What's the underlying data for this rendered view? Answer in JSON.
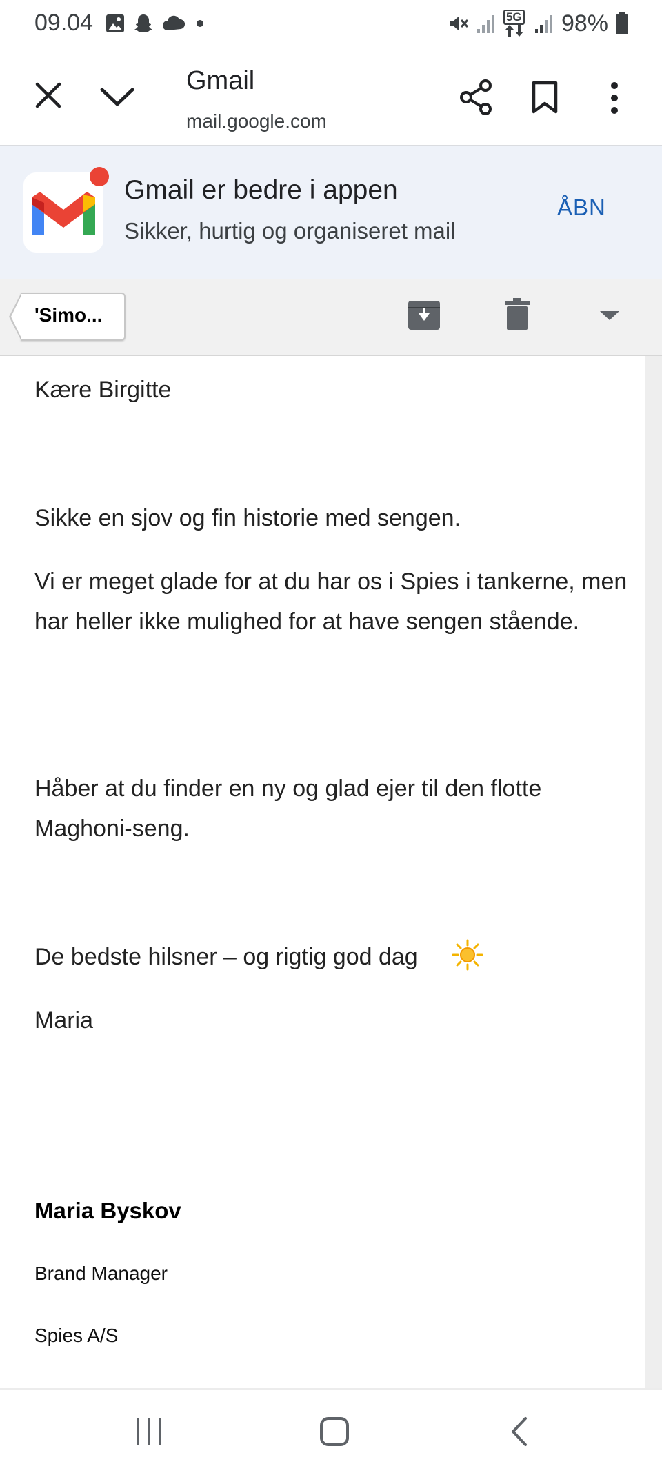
{
  "status_bar": {
    "time": "09.04",
    "network": "5G",
    "battery": "98%",
    "left_icons": [
      "gallery-icon",
      "snapchat-icon",
      "cloud-icon",
      "dot-icon"
    ],
    "right_icons": [
      "mute-icon",
      "signal-icon",
      "signal-icon",
      "battery-icon"
    ]
  },
  "browser": {
    "title": "Gmail",
    "url": "mail.google.com",
    "icons": [
      "close-icon",
      "chevron-down-icon",
      "share-icon",
      "bookmark-icon",
      "more-vert-icon"
    ]
  },
  "app_banner": {
    "title": "Gmail er bedre i appen",
    "subtitle": "Sikker, hurtig og organiseret mail",
    "open_label": "ÅBN",
    "logo_colors": {
      "blue": "#4285f4",
      "red": "#ea4335",
      "yellow": "#fbbc04",
      "green": "#34a853"
    }
  },
  "mail_toolbar": {
    "back_label": "'Simo...",
    "icons": [
      "archive-icon",
      "trash-icon",
      "dropdown-icon"
    ]
  },
  "email": {
    "greeting": "Kære Birgitte",
    "paragraphs": [
      "Sikke en sjov og fin historie med sengen.",
      "Vi er meget glade for at du har os i Spies i tankerne, men har heller ikke mulighed for at have sengen stående.",
      "Håber at du finder en ny og glad ejer til den flotte Maghoni-seng.",
      "De bedste hilsner – og rigtig god dag"
    ],
    "closing_name": "Maria",
    "signature": {
      "name": "Maria Byskov",
      "title": "Brand Manager",
      "company": "Spies A/S"
    },
    "emoji": "sun-icon"
  },
  "nav_bar": {
    "icons": [
      "recents-icon",
      "home-icon",
      "back-icon"
    ]
  }
}
